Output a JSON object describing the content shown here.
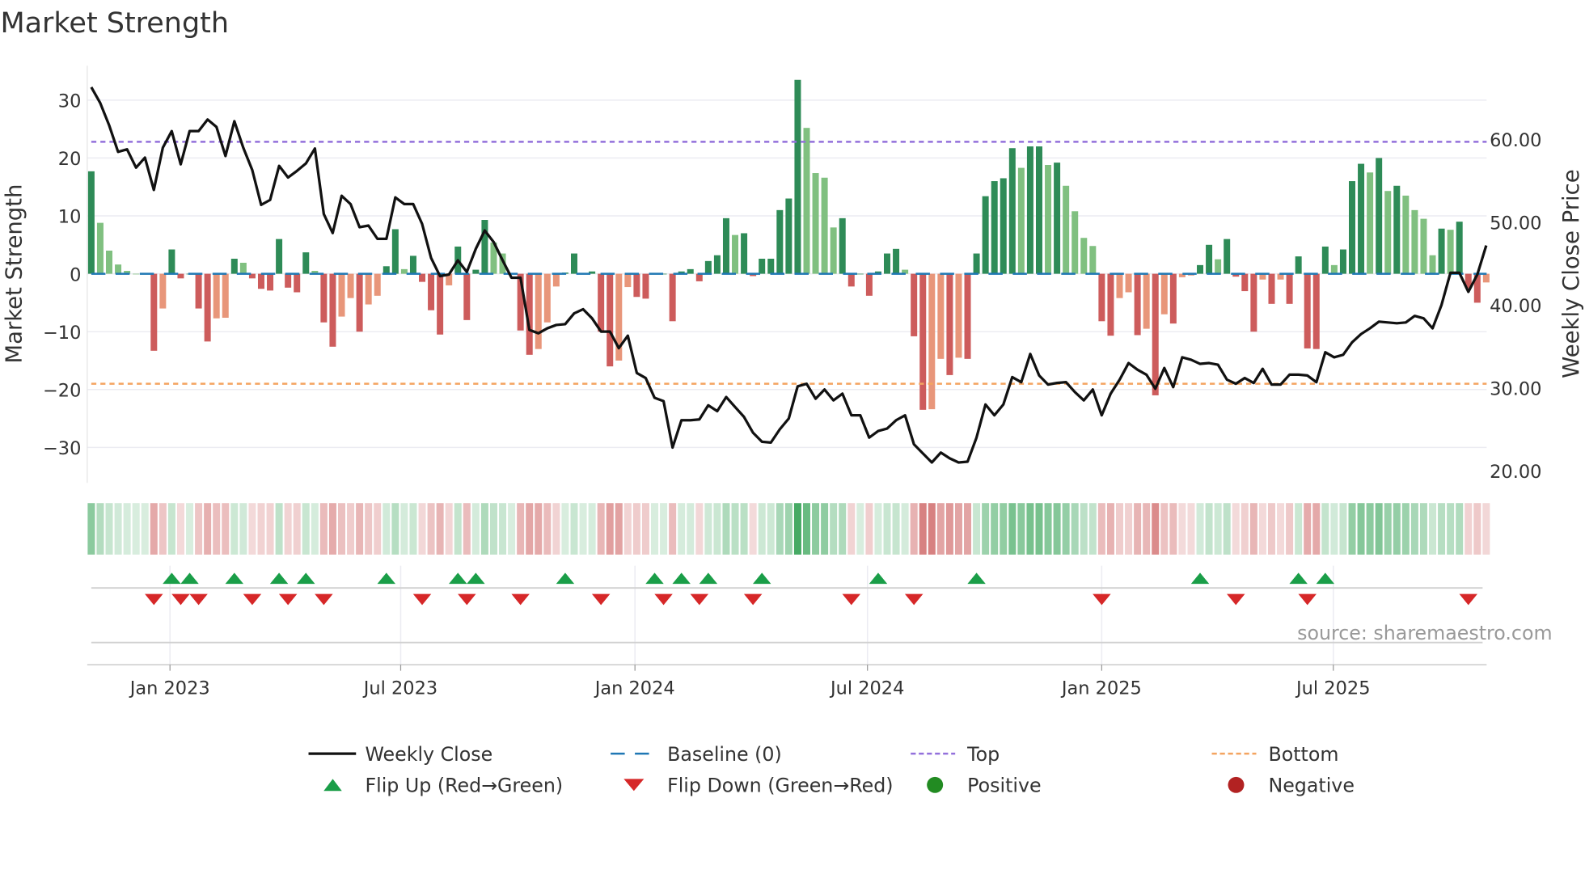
{
  "title": "Market Strength",
  "source": "source: sharemaestro.com",
  "chart_data": {
    "type": "bar",
    "title": "Market Strength",
    "ylabel": "Market Strength",
    "y2label": "Weekly Close Price",
    "ylim": [
      -35,
      36
    ],
    "y2lim": [
      17,
      68
    ],
    "yticks": [
      {
        "v": 30,
        "label": "30"
      },
      {
        "v": 20,
        "label": "20"
      },
      {
        "v": 10,
        "label": "10"
      },
      {
        "v": 0,
        "label": "0"
      },
      {
        "v": -10,
        "label": "−10"
      },
      {
        "v": -20,
        "label": "−20"
      },
      {
        "v": -30,
        "label": "−30"
      }
    ],
    "y2ticks": [
      {
        "v": 60,
        "label": "60.00"
      },
      {
        "v": 50,
        "label": "50.00"
      },
      {
        "v": 40,
        "label": "40.00"
      },
      {
        "v": 30,
        "label": "30.00"
      },
      {
        "v": 20,
        "label": "20.00"
      }
    ],
    "xticks": [
      {
        "week": 8.8,
        "label": "Jan 2023"
      },
      {
        "week": 34.6,
        "label": "Jul 2023"
      },
      {
        "week": 60.8,
        "label": "Jan 2024"
      },
      {
        "week": 86.8,
        "label": "Jul 2024"
      },
      {
        "week": 113,
        "label": "Jan 2025"
      },
      {
        "week": 138.9,
        "label": "Jul 2025"
      }
    ],
    "top_level": 22.8,
    "bottom_level": -19,
    "baseline": 0,
    "strength": [
      17.7,
      8.8,
      4,
      1.6,
      0.5,
      0,
      0.1,
      -13.3,
      -6,
      4.2,
      -0.8,
      0,
      -6,
      -11.7,
      -7.7,
      -7.6,
      2.6,
      1.9,
      -0.8,
      -2.6,
      -2.9,
      6,
      -2.4,
      -3.2,
      3.7,
      0.5,
      -8.4,
      -12.6,
      -7.4,
      -4.2,
      -10,
      -5.3,
      -3.8,
      1.3,
      7.7,
      0.8,
      3.1,
      -1.4,
      -6.3,
      -10.5,
      -2,
      4.7,
      -8,
      0.7,
      9.3,
      5.4,
      3.5,
      0,
      -9.8,
      -14,
      -13,
      -8.4,
      -2.2,
      0.2,
      3.5,
      0.1,
      0.4,
      -10,
      -16,
      -15,
      -2.3,
      -4,
      -4.3,
      0,
      0,
      -8.2,
      0.4,
      0.8,
      -1.3,
      2.2,
      3.2,
      9.6,
      6.7,
      7,
      -0.4,
      2.6,
      2.6,
      11,
      13,
      33.5,
      25.2,
      17.4,
      16.6,
      8,
      9.6,
      -2.2,
      0,
      -3.8,
      0.4,
      3.5,
      4.3,
      0.7,
      -10.8,
      -23.5,
      -23.4,
      -14.7,
      -17.5,
      -14.5,
      -14.7,
      3.5,
      13.4,
      16,
      16.5,
      21.7,
      18.3,
      22,
      22,
      18.8,
      19.2,
      15.2,
      10.8,
      6.2,
      4.8,
      -8.2,
      -10.7,
      -4.2,
      -3.2,
      -10.6,
      -9.5,
      -21,
      -7,
      -8.6,
      -0.6,
      -0.3,
      1.5,
      5,
      2.5,
      6,
      -0.5,
      -3,
      -10,
      -1,
      -5.2,
      -1,
      -5.2,
      3,
      -12.9,
      -13,
      4.7,
      1.5,
      4.2,
      16,
      19,
      17.5,
      20,
      14.3,
      15.2,
      13.5,
      11,
      9.5,
      3.2,
      7.8,
      7.6,
      9,
      -2.5,
      -5,
      -1.5
    ],
    "weekly_close": [
      66.3,
      64.4,
      61.7,
      58.5,
      58.8,
      56.6,
      57.8,
      53.9,
      59,
      61,
      57,
      61,
      61,
      62.4,
      61.5,
      58,
      62.2,
      59,
      56.3,
      52.1,
      52.7,
      56.8,
      55.4,
      56.2,
      57.1,
      58.9,
      51,
      48.7,
      53.2,
      52.2,
      49.4,
      49.6,
      48,
      48,
      53,
      52.2,
      52.2,
      49.8,
      45.7,
      43.5,
      43.7,
      45.4,
      44,
      46.8,
      49,
      47.6,
      45.4,
      43.3,
      43.3,
      37,
      36.6,
      37.2,
      37.6,
      37.7,
      39,
      39.5,
      38.4,
      36.8,
      36.8,
      34.8,
      36.3,
      31.8,
      31.2,
      28.8,
      28.4,
      22.8,
      26.1,
      26.1,
      26.2,
      27.9,
      27.2,
      28.9,
      27.7,
      26.5,
      24.6,
      23.5,
      23.4,
      25,
      26.3,
      30.2,
      30.5,
      28.7,
      29.8,
      28.5,
      29.3,
      26.7,
      26.7,
      24,
      24.8,
      25.1,
      26.1,
      26.7,
      23.2,
      22.1,
      21,
      22.2,
      21.5,
      21,
      21.1,
      24,
      28,
      26.7,
      28,
      31.3,
      30.7,
      34.1,
      31.5,
      30.4,
      30.6,
      30.7,
      29.5,
      28.5,
      29.8,
      26.7,
      29.3,
      31,
      33,
      32.2,
      31.6,
      29.9,
      32.4,
      30.1,
      33.7,
      33.4,
      32.9,
      33,
      32.8,
      31,
      30.5,
      31.2,
      30.6,
      32.3,
      30.4,
      30.4,
      31.6,
      31.6,
      31.5,
      30.7,
      34.3,
      33.7,
      34,
      35.5,
      36.5,
      37.2,
      38,
      37.9,
      37.8,
      37.9,
      38.7,
      38.4,
      37.2,
      40,
      43.9,
      43.9,
      41.6,
      43.7,
      47.2
    ],
    "flip_up_weeks": [
      9,
      11,
      16,
      21,
      24,
      33,
      41,
      43,
      53,
      63,
      66,
      69,
      75,
      88,
      99,
      124,
      135,
      138
    ],
    "flip_down_weeks": [
      7,
      10,
      12,
      18,
      22,
      26,
      37,
      42,
      48,
      57,
      64,
      68,
      74,
      85,
      92,
      113,
      128,
      136,
      154
    ],
    "colors": {
      "green_rising": "#2e8b57",
      "green_falling": "#80c080",
      "red_falling": "#cd5c5c",
      "red_rising": "#e8967a",
      "close": "#111111",
      "baseline": "#1f77b4",
      "top": "#9370db",
      "bottom": "#f4a460",
      "flip_up": "#1a9e48",
      "flip_down": "#d62728",
      "positive": "#228b22",
      "negative": "#b22222"
    },
    "legend": {
      "placement": "bottom",
      "items": [
        {
          "label": "Weekly Close",
          "kind": "line"
        },
        {
          "label": "Baseline (0)",
          "kind": "baseline"
        },
        {
          "label": "Top",
          "kind": "top"
        },
        {
          "label": "Bottom",
          "kind": "bottom"
        },
        {
          "label": "Flip Up (Red→Green)",
          "kind": "up"
        },
        {
          "label": "Flip Down (Green→Red)",
          "kind": "down"
        },
        {
          "label": "Positive",
          "kind": "pos"
        },
        {
          "label": "Negative",
          "kind": "neg"
        }
      ]
    }
  }
}
